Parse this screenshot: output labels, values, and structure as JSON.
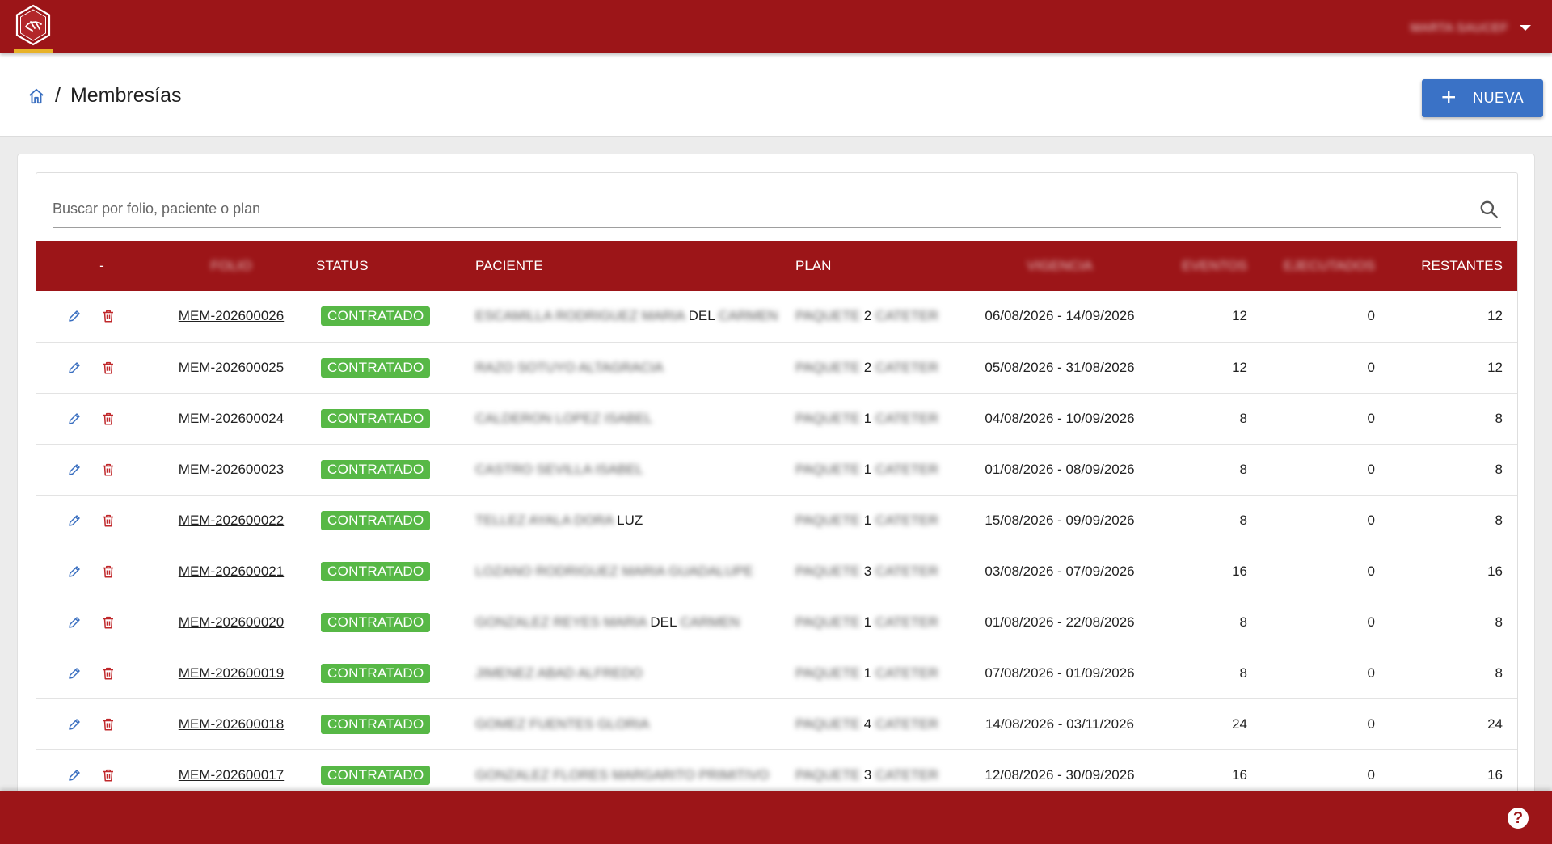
{
  "app": {
    "user_name": "MARTA SAUCEF"
  },
  "breadcrumb": {
    "separator": "/",
    "title": "Membresías"
  },
  "actions": {
    "new_label": "NUEVA"
  },
  "search": {
    "placeholder": "Buscar por folio, paciente o plan"
  },
  "table": {
    "headers": {
      "actions": "-",
      "folio": "FOLIO",
      "status": "STATUS",
      "paciente": "PACIENTE",
      "plan": "PLAN",
      "vigencia": "VIGENCIA",
      "eventos": "EVENTOS",
      "ejecutados": "EJECUTADOS",
      "restantes": "RESTANTES"
    },
    "rows": [
      {
        "folio": "MEM-202600026",
        "status": "CONTRATADO",
        "paciente_blur": "ESCAMILLA RODRIGUEZ MARIA",
        "paciente_clear": "DEL",
        "paciente_blur2": "CARMEN",
        "plan_pre": "PAQUETE",
        "plan_num": "2",
        "plan_post": "CATETER",
        "vigencia": "06/08/2026 - 14/09/2026",
        "eventos": "12",
        "ejecutados": "0",
        "restantes": "12"
      },
      {
        "folio": "MEM-202600025",
        "status": "CONTRATADO",
        "paciente_blur": "RAZO SOTUYO ALTAGRACIA",
        "paciente_clear": "",
        "paciente_blur2": "",
        "plan_pre": "PAQUETE",
        "plan_num": "2",
        "plan_post": "CATETER",
        "vigencia": "05/08/2026 - 31/08/2026",
        "eventos": "12",
        "ejecutados": "0",
        "restantes": "12"
      },
      {
        "folio": "MEM-202600024",
        "status": "CONTRATADO",
        "paciente_blur": "CALDERON LOPEZ ISABEL",
        "paciente_clear": "",
        "paciente_blur2": "",
        "plan_pre": "PAQUETE",
        "plan_num": "1",
        "plan_post": "CATETER",
        "vigencia": "04/08/2026 - 10/09/2026",
        "eventos": "8",
        "ejecutados": "0",
        "restantes": "8"
      },
      {
        "folio": "MEM-202600023",
        "status": "CONTRATADO",
        "paciente_blur": "CASTRO SEVILLA ISABEL",
        "paciente_clear": "",
        "paciente_blur2": "",
        "plan_pre": "PAQUETE",
        "plan_num": "1",
        "plan_post": "CATETER",
        "vigencia": "01/08/2026 - 08/09/2026",
        "eventos": "8",
        "ejecutados": "0",
        "restantes": "8"
      },
      {
        "folio": "MEM-202600022",
        "status": "CONTRATADO",
        "paciente_blur": "TELLEZ AYALA DORA",
        "paciente_clear": "LUZ",
        "paciente_blur2": "",
        "plan_pre": "PAQUETE",
        "plan_num": "1",
        "plan_post": "CATETER",
        "vigencia": "15/08/2026 - 09/09/2026",
        "eventos": "8",
        "ejecutados": "0",
        "restantes": "8"
      },
      {
        "folio": "MEM-202600021",
        "status": "CONTRATADO",
        "paciente_blur": "LOZANO RODRIGUEZ MARIA GUADALUPE",
        "paciente_clear": "",
        "paciente_blur2": "",
        "plan_pre": "PAQUETE",
        "plan_num": "3",
        "plan_post": "CATETER",
        "vigencia": "03/08/2026 - 07/09/2026",
        "eventos": "16",
        "ejecutados": "0",
        "restantes": "16"
      },
      {
        "folio": "MEM-202600020",
        "status": "CONTRATADO",
        "paciente_blur": "GONZALEZ REYES MARIA",
        "paciente_clear": "DEL",
        "paciente_blur2": "CARMEN",
        "plan_pre": "PAQUETE",
        "plan_num": "1",
        "plan_post": "CATETER",
        "vigencia": "01/08/2026 - 22/08/2026",
        "eventos": "8",
        "ejecutados": "0",
        "restantes": "8"
      },
      {
        "folio": "MEM-202600019",
        "status": "CONTRATADO",
        "paciente_blur": "JIMENEZ ABAD ALFREDO",
        "paciente_clear": "",
        "paciente_blur2": "",
        "plan_pre": "PAQUETE",
        "plan_num": "1",
        "plan_post": "CATETER",
        "vigencia": "07/08/2026 - 01/09/2026",
        "eventos": "8",
        "ejecutados": "0",
        "restantes": "8"
      },
      {
        "folio": "MEM-202600018",
        "status": "CONTRATADO",
        "paciente_blur": "GOMEZ FUENTES GLORIA",
        "paciente_clear": "",
        "paciente_blur2": "",
        "plan_pre": "PAQUETE",
        "plan_num": "4",
        "plan_post": "CATETER",
        "vigencia": "14/08/2026 - 03/11/2026",
        "eventos": "24",
        "ejecutados": "0",
        "restantes": "24"
      },
      {
        "folio": "MEM-202600017",
        "status": "CONTRATADO",
        "paciente_blur": "GONZALEZ FLORES MARGARITO PRIMITIVO",
        "paciente_clear": "",
        "paciente_blur2": "",
        "plan_pre": "PAQUETE",
        "plan_num": "3",
        "plan_post": "CATETER",
        "vigencia": "12/08/2026 - 30/09/2026",
        "eventos": "16",
        "ejecutados": "0",
        "restantes": "16"
      }
    ]
  },
  "footer": {
    "help_label": "?"
  },
  "colors": {
    "brand_red": "#9c1518",
    "accent_yellow": "#e8b228",
    "primary_blue": "#3a72c6",
    "status_green": "#57b846",
    "edit_blue": "#3a6fc0",
    "delete_red": "#c0282b"
  },
  "icons": {
    "logo": "hexagon-logo-icon",
    "home": "home-icon",
    "search": "search-icon",
    "edit": "pencil-icon",
    "delete": "trash-icon",
    "help": "help-icon",
    "menu": "chevron-down-icon"
  }
}
